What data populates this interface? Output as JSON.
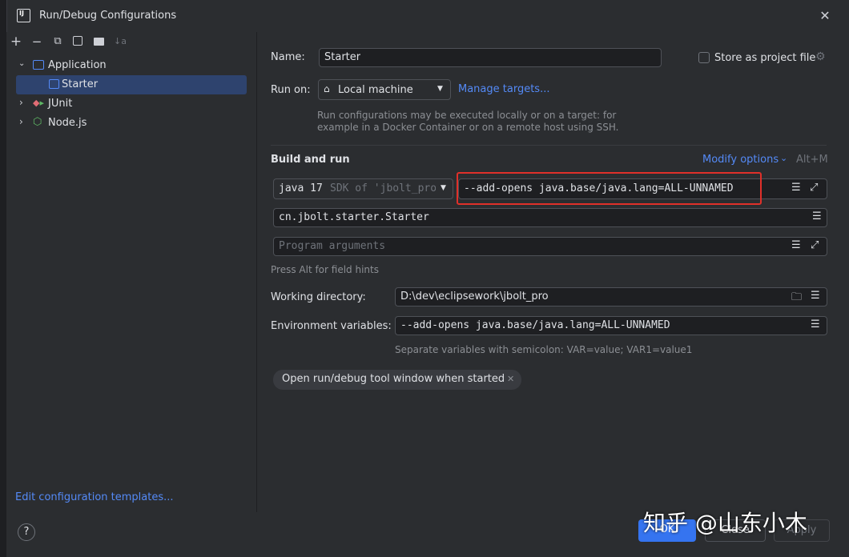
{
  "window": {
    "title": "Run/Debug Configurations",
    "logo_text": "IJ"
  },
  "toolbar": {
    "add": "+",
    "remove": "−",
    "copy": "⧉",
    "save": "💾",
    "folder": "📁",
    "sort": "↓a"
  },
  "tree": {
    "application": "Application",
    "starter": "Starter",
    "junit": "JUnit",
    "nodejs": "Node.js"
  },
  "edit_templates": "Edit configuration templates...",
  "form": {
    "name_label": "Name:",
    "name_value": "Starter",
    "store_label": "Store as project file",
    "run_on_label": "Run on:",
    "run_on_value": "Local machine",
    "manage_targets": "Manage targets...",
    "run_hint_1": "Run configurations may be executed locally or on a target: for",
    "run_hint_2": "example in a Docker Container or on a remote host using SSH.",
    "build_run": "Build and run",
    "modify_options": "Modify options",
    "modify_shortcut": "Alt+M",
    "jdk_main": "java 17",
    "jdk_sub": "SDK of 'jbolt_pro",
    "vm_options": "--add-opens java.base/java.lang=ALL-UNNAMED",
    "main_class": "cn.jbolt.starter.Starter",
    "program_args_placeholder": "Program arguments",
    "field_hints": "Press Alt for field hints",
    "working_dir_label": "Working directory:",
    "working_dir_value": "D:\\dev\\eclipsework\\jbolt_pro",
    "env_label": "Environment variables:",
    "env_value": "--add-opens java.base/java.lang=ALL-UNNAMED",
    "env_hint": "Separate variables with semicolon: VAR=value; VAR1=value1",
    "chip_label": "Open run/debug tool window when started"
  },
  "buttons": {
    "help": "?",
    "ok": "OK",
    "close": "Close",
    "apply": "Apply"
  },
  "watermark": "知乎 @山东小木",
  "colors": {
    "accent": "#548af7",
    "selection": "#2e436e",
    "highlight_box": "#e0302a",
    "ok_button": "#3574f0"
  }
}
